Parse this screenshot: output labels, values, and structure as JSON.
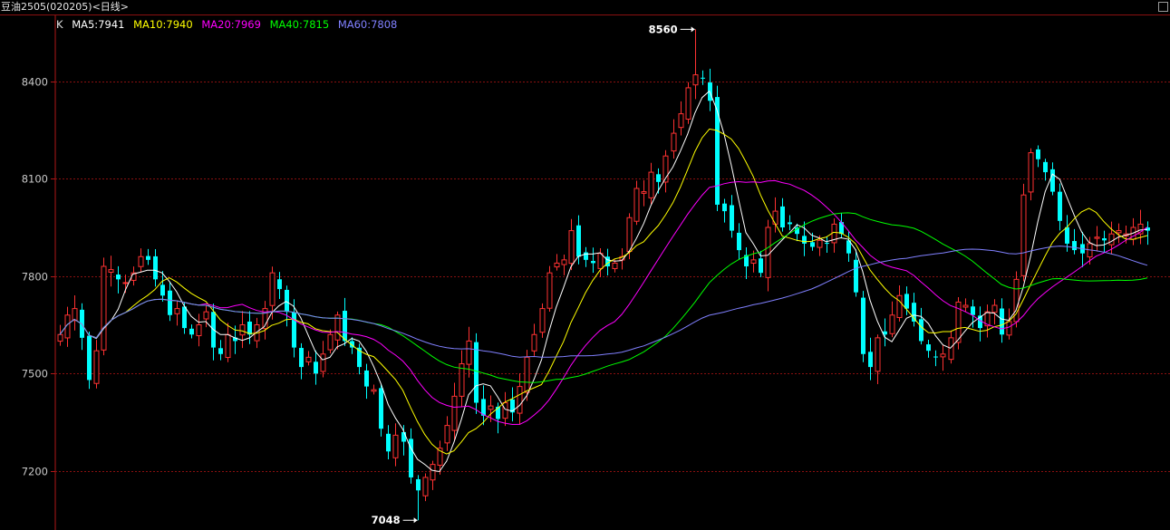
{
  "title": "豆油2505(020205)<日线>",
  "legend": [
    {
      "key": "k",
      "text": "K",
      "color": "#e6e6e6"
    },
    {
      "key": "ma5",
      "text": "MA5:7941",
      "color": "#ffffff"
    },
    {
      "key": "ma10",
      "text": "MA10:7940",
      "color": "#ffff00"
    },
    {
      "key": "ma20",
      "text": "MA20:7969",
      "color": "#ff00ff"
    },
    {
      "key": "ma40",
      "text": "MA40:7815",
      "color": "#00ff00"
    },
    {
      "key": "ma60",
      "text": "MA60:7808",
      "color": "#8080ff"
    }
  ],
  "colors": {
    "up": "#ff3232",
    "down": "#00ffff",
    "grid": "#8a1010",
    "axis_text": "#c8c8c8",
    "marker": "#ffffff"
  },
  "chart_data": {
    "type": "candlestick",
    "y_ticks": [
      7200,
      7500,
      7800,
      8100,
      8400
    ],
    "ylim": [
      7018,
      8603
    ],
    "grid": true,
    "annotations": [
      {
        "label": "8560",
        "value": 8560,
        "kind": "max"
      },
      {
        "label": "7048",
        "value": 7048,
        "kind": "min"
      }
    ],
    "closes": [
      7620,
      7680,
      7700,
      7610,
      7480,
      7570,
      7830,
      7820,
      7790,
      7780,
      7810,
      7860,
      7850,
      7790,
      7740,
      7680,
      7700,
      7640,
      7620,
      7650,
      7690,
      7580,
      7560,
      7620,
      7600,
      7650,
      7620,
      7650,
      7700,
      7810,
      7760,
      7690,
      7580,
      7520,
      7550,
      7500,
      7560,
      7620,
      7680,
      7600,
      7580,
      7520,
      7460,
      7450,
      7330,
      7260,
      7310,
      7290,
      7180,
      7140,
      7180,
      7220,
      7270,
      7340,
      7430,
      7530,
      7600,
      7410,
      7370,
      7400,
      7360,
      7410,
      7380,
      7460,
      7550,
      7620,
      7700,
      7810,
      7840,
      7850,
      7940,
      7860,
      7850,
      7840,
      7870,
      7830,
      7840,
      7860,
      7980,
      8070,
      8060,
      8120,
      8090,
      8170,
      8240,
      8300,
      8380,
      8420,
      8410,
      8340,
      8020,
      8000,
      7940,
      7880,
      7830,
      7850,
      7810,
      7950,
      8000,
      7950,
      7960,
      7930,
      7900,
      7890,
      7910,
      7900,
      7960,
      7930,
      7870,
      7750,
      7560,
      7520,
      7610,
      7620,
      7680,
      7740,
      7700,
      7660,
      7600,
      7570,
      7550,
      7560,
      7610,
      7720,
      7710,
      7680,
      7640,
      7690,
      7710,
      7620,
      7660,
      7790,
      8050,
      8180,
      8160,
      8120,
      8060,
      7970,
      7900,
      7880,
      7870,
      7900,
      7920,
      7910,
      7930,
      7940,
      7930,
      7950,
      7960,
      7940
    ],
    "series": [
      {
        "name": "MA5",
        "color": "#ffffff",
        "last": 7941
      },
      {
        "name": "MA10",
        "color": "#ffff00",
        "last": 7940
      },
      {
        "name": "MA20",
        "color": "#ff00ff",
        "last": 7969
      },
      {
        "name": "MA40",
        "color": "#00ff00",
        "last": 7815
      },
      {
        "name": "MA60",
        "color": "#8080ff",
        "last": 7808
      }
    ]
  }
}
